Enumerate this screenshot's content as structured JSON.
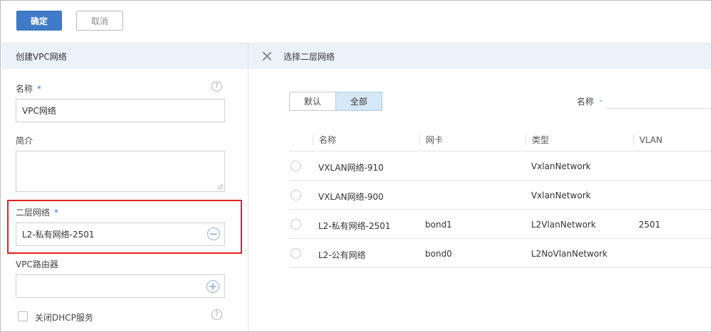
{
  "toolbar": {
    "confirm_label": "确定",
    "cancel_label": "取消"
  },
  "left_panel": {
    "title": "创建VPC网络",
    "name_label": "名称",
    "name_value": "VPC网络",
    "desc_label": "简介",
    "desc_value": "",
    "l2_label": "二层网络",
    "l2_value": "L2-私有网络-2501",
    "router_label": "VPC路由器",
    "router_value": "",
    "dhcp_label": "关闭DHCP服务",
    "required_mark": "*",
    "help_glyph": "?",
    "remove_glyph": "−",
    "add_glyph": "+"
  },
  "right_panel": {
    "title": "选择二层网络",
    "segments": [
      "默认",
      "全部"
    ],
    "active_segment": "全部",
    "search_field_label": "名称",
    "search_chevron": "⌄",
    "columns": [
      "名称",
      "网卡",
      "类型",
      "VLAN"
    ],
    "rows": [
      {
        "name": "VXLAN网络-910",
        "nic": "",
        "type": "VxlanNetwork",
        "vlan": ""
      },
      {
        "name": "VXLAN网络-900",
        "nic": "",
        "type": "VxlanNetwork",
        "vlan": ""
      },
      {
        "name": "L2-私有网络-2501",
        "nic": "bond1",
        "type": "L2VlanNetwork",
        "vlan": "2501"
      },
      {
        "name": "L2-公有网络",
        "nic": "bond0",
        "type": "L2NoVlanNetwork",
        "vlan": ""
      }
    ]
  },
  "colors": {
    "primary": "#3f7bc6",
    "header_bg": "#ebf2f9",
    "highlight_border": "#e02020",
    "active_segment_bg": "#d6e8f7"
  }
}
